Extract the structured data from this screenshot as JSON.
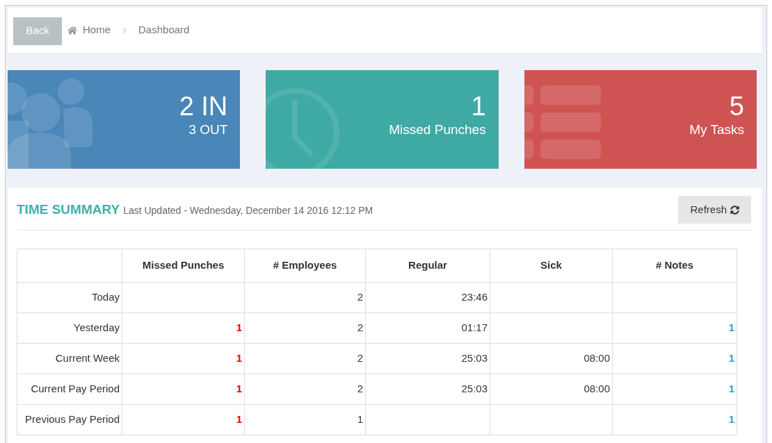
{
  "header": {
    "back_button": "Back",
    "breadcrumb": [
      "Home",
      "Dashboard"
    ]
  },
  "cards": [
    {
      "kind": "users",
      "color": "#4a86b8",
      "value": "2 IN",
      "label": "3 OUT"
    },
    {
      "kind": "clock",
      "color": "#3faaa4",
      "value": "1",
      "label": "Missed Punches"
    },
    {
      "kind": "tasks",
      "color": "#cf5353",
      "value": "5",
      "label": "My Tasks"
    }
  ],
  "time_summary": {
    "title": "TIME SUMMARY",
    "updated": "Last Updated - Wednesday, December 14 2016 12:12 PM",
    "refresh_button": "Refresh",
    "columns": [
      "Missed Punches",
      "# Employees",
      "Regular",
      "Sick",
      "# Notes"
    ],
    "rows": [
      {
        "label": "Today",
        "missed": "",
        "employees": "2",
        "regular": "23:46",
        "sick": "",
        "notes": ""
      },
      {
        "label": "Yesterday",
        "missed": "1",
        "employees": "2",
        "regular": "01:17",
        "sick": "",
        "notes": "1"
      },
      {
        "label": "Current Week",
        "missed": "1",
        "employees": "2",
        "regular": "25:03",
        "sick": "08:00",
        "notes": "1"
      },
      {
        "label": "Current Pay Period",
        "missed": "1",
        "employees": "2",
        "regular": "25:03",
        "sick": "08:00",
        "notes": "1"
      },
      {
        "label": "Previous Pay Period",
        "missed": "1",
        "employees": "1",
        "regular": "",
        "sick": "",
        "notes": "1"
      }
    ]
  }
}
